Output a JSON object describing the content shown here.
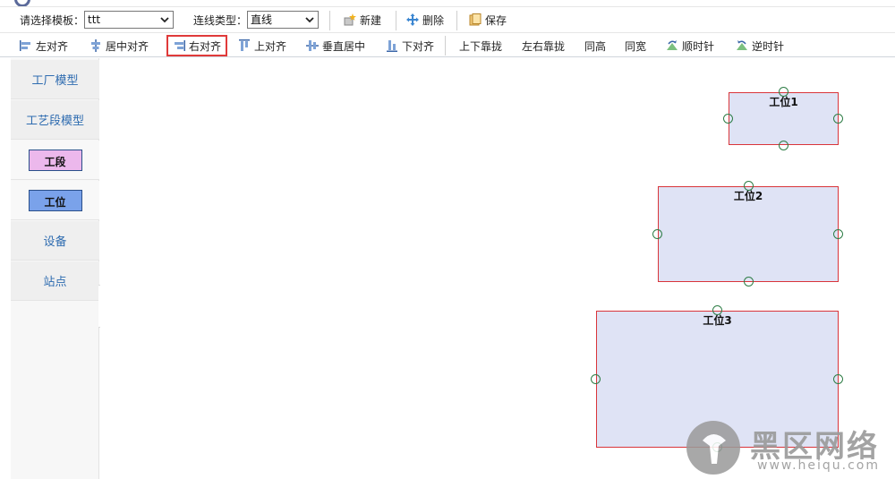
{
  "app": {
    "title": ""
  },
  "toolbar1": {
    "template_label": "请选择模板：",
    "template_value": "ttt",
    "line_type_label": "连线类型：",
    "line_type_value": "直线",
    "new_label": "新建",
    "delete_label": "删除",
    "save_label": "保存"
  },
  "toolbar2": {
    "items": [
      {
        "label": "左对齐",
        "icon": "align-left-icon"
      },
      {
        "label": "居中对齐",
        "icon": "align-center-icon"
      },
      {
        "label": "右对齐",
        "icon": "align-right-icon",
        "active": true
      },
      {
        "label": "上对齐",
        "icon": "align-top-icon"
      },
      {
        "label": "垂直居中",
        "icon": "align-middle-icon"
      },
      {
        "label": "下对齐",
        "icon": "align-bottom-icon"
      },
      {
        "label": "上下靠拢",
        "icon": ""
      },
      {
        "label": "左右靠拢",
        "icon": ""
      },
      {
        "label": "同高",
        "icon": ""
      },
      {
        "label": "同宽",
        "icon": ""
      },
      {
        "label": "顺时针",
        "icon": "rotate-cw-icon"
      },
      {
        "label": "逆时针",
        "icon": "rotate-ccw-icon"
      }
    ]
  },
  "sidebar": {
    "items": [
      {
        "label": "工厂模型"
      },
      {
        "label": "工艺段模型"
      },
      {
        "label": "工段",
        "chip_color": "#ecb8ec"
      },
      {
        "label": "工位",
        "chip_color": "#7aa2ea"
      },
      {
        "label": "设备"
      },
      {
        "label": "站点"
      }
    ]
  },
  "canvas": {
    "nodes": [
      {
        "label": "工位1"
      },
      {
        "label": "工位2"
      },
      {
        "label": "工位3"
      }
    ]
  },
  "watermark": {
    "big": "黑区网络",
    "small": "www.heiqu.com"
  },
  "colors": {
    "accent": "#2f6cb0",
    "node_fill": "#dfe3f5",
    "node_border": "#d9353a",
    "handle": "#2e7d46"
  }
}
